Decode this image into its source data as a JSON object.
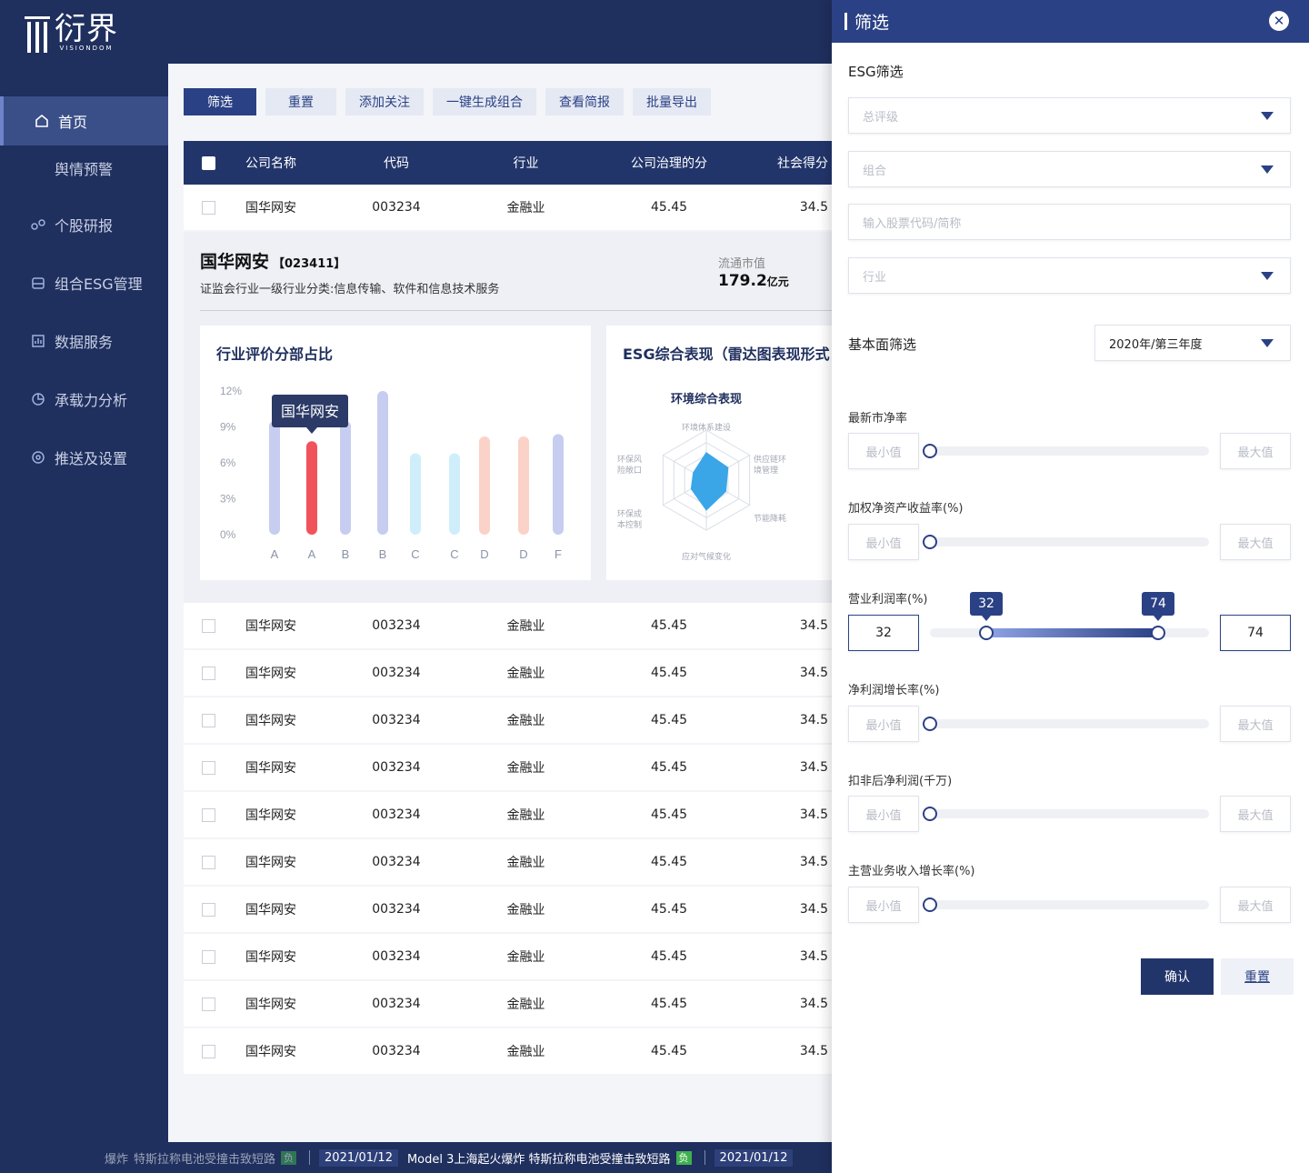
{
  "app": {
    "logo_text": "衍界",
    "logo_sub": "VISIONDOM"
  },
  "sidebar": {
    "items": [
      {
        "label": "首页",
        "icon": "home-icon"
      },
      {
        "label": "舆情预警",
        "icon": ""
      },
      {
        "label": "个股研报",
        "icon": "research-icon"
      },
      {
        "label": "组合ESG管理",
        "icon": "portfolio-icon"
      },
      {
        "label": "数据服务",
        "icon": "chart-icon"
      },
      {
        "label": "承载力分析",
        "icon": "pie-icon"
      },
      {
        "label": "推送及设置",
        "icon": "settings-icon"
      }
    ]
  },
  "toolbar": {
    "filter": "筛选",
    "reset": "重置",
    "add_watch": "添加关注",
    "generate": "一键生成组合",
    "view_report": "查看简报",
    "export": "批量导出"
  },
  "table": {
    "headers": {
      "name": "公司名称",
      "code": "代码",
      "industry": "行业",
      "governance": "公司治理的分",
      "social": "社会得分"
    },
    "first_row": {
      "name": "国华网安",
      "code": "003234",
      "industry": "金融业",
      "governance": "45.45",
      "social": "34.5"
    },
    "rows": [
      {
        "name": "国华网安",
        "code": "003234",
        "industry": "金融业",
        "governance": "45.45",
        "social": "34.5"
      },
      {
        "name": "国华网安",
        "code": "003234",
        "industry": "金融业",
        "governance": "45.45",
        "social": "34.5"
      },
      {
        "name": "国华网安",
        "code": "003234",
        "industry": "金融业",
        "governance": "45.45",
        "social": "34.5"
      },
      {
        "name": "国华网安",
        "code": "003234",
        "industry": "金融业",
        "governance": "45.45",
        "social": "34.5"
      },
      {
        "name": "国华网安",
        "code": "003234",
        "industry": "金融业",
        "governance": "45.45",
        "social": "34.5"
      },
      {
        "name": "国华网安",
        "code": "003234",
        "industry": "金融业",
        "governance": "45.45",
        "social": "34.5"
      },
      {
        "name": "国华网安",
        "code": "003234",
        "industry": "金融业",
        "governance": "45.45",
        "social": "34.5"
      },
      {
        "name": "国华网安",
        "code": "003234",
        "industry": "金融业",
        "governance": "45.45",
        "social": "34.5"
      },
      {
        "name": "国华网安",
        "code": "003234",
        "industry": "金融业",
        "governance": "45.45",
        "social": "34.5"
      },
      {
        "name": "国华网安",
        "code": "003234",
        "industry": "金融业",
        "governance": "45.45",
        "social": "34.5"
      }
    ]
  },
  "detail": {
    "company": "国华网安",
    "code": "【023411】",
    "classification": "证监会行业一级行业分类:信息传输、软件和信息技术服务",
    "market_value_label": "流通市值",
    "market_value": "179.2",
    "market_value_unit": "亿元",
    "bar_card_title": "行业评价分部占比",
    "radar_card_title": "ESG综合表现（雷达图表现形式：",
    "tooltip": "国华网安"
  },
  "chart_data": [
    {
      "type": "bar",
      "title": "行业评价分部占比",
      "categories": [
        "A",
        "A",
        "B",
        "B",
        "C",
        "C",
        "D",
        "D",
        "F"
      ],
      "values": [
        9.5,
        7.8,
        9.5,
        12,
        6.8,
        6.8,
        8.2,
        8.2,
        8.4
      ],
      "highlight_index": 1,
      "yticks": [
        "0%",
        "3%",
        "6%",
        "9%",
        "12%"
      ],
      "ylim": [
        0,
        12
      ],
      "colors": [
        "#c7cdf0",
        "#f0545a",
        "#c7cdf0",
        "#c7cdf0",
        "#cfeefb",
        "#cfeefb",
        "#fbd2c8",
        "#fbd2c8",
        "#c7cdf0"
      ]
    },
    {
      "type": "radar",
      "title": "环境综合表现",
      "axes": [
        "环境体系建设",
        "供应链环境管理",
        "节能降耗",
        "应对气候变化",
        "环保成本控制",
        "环保风险敞口"
      ],
      "values": [
        0.55,
        0.5,
        0.45,
        0.6,
        0.35,
        0.3
      ],
      "color": "#3aa6e8"
    }
  ],
  "panel": {
    "title": "筛选",
    "esg_label": "ESG筛选",
    "rating_placeholder": "总评级",
    "group_placeholder": "组合",
    "stock_placeholder": "输入股票代码/简称",
    "industry_placeholder": "行业",
    "fundamental_label": "基本面筛选",
    "period_value": "2020年/第三年度",
    "min_placeholder": "最小值",
    "max_placeholder": "最大值",
    "ranges": [
      {
        "label": "最新市净率"
      },
      {
        "label": "加权净资产收益率(%)"
      },
      {
        "label": "营业利润率(%)",
        "min": "32",
        "max": "74"
      },
      {
        "label": "净利润增长率(%)"
      },
      {
        "label": "扣非后净利润(千万)"
      },
      {
        "label": "主营业务收入增长率(%)"
      }
    ],
    "confirm": "确认",
    "reset": "重置"
  },
  "ticker": {
    "partial_prefix": "爆炸",
    "item_text": "特斯拉称电池受撞击致短路",
    "badge": "负",
    "date": "2021/01/12",
    "item2_text": "Model 3上海起火爆炸 特斯拉称电池受撞击致短路",
    "date2": "2021/01/12"
  }
}
